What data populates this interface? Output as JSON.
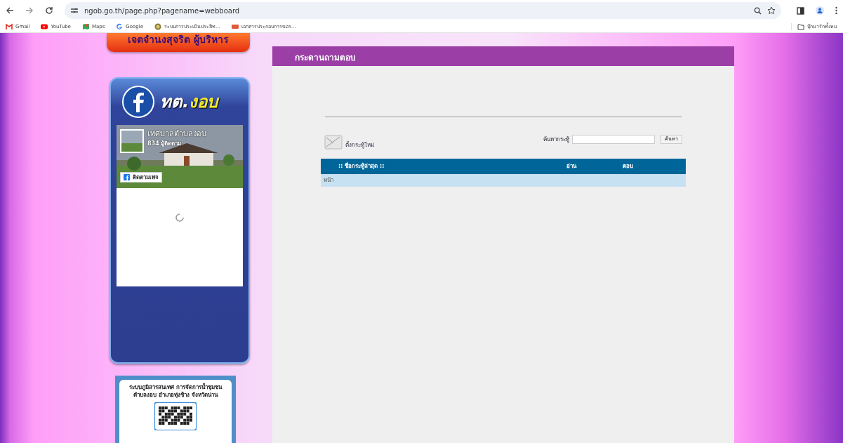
{
  "browser": {
    "url": "ngob.go.th/page.php?pagename=webboard",
    "bookmarks": [
      {
        "label": "Gmail",
        "kind": "gmail"
      },
      {
        "label": "YouTube",
        "kind": "youtube"
      },
      {
        "label": "Maps",
        "kind": "maps"
      },
      {
        "label": "Google",
        "kind": "google"
      },
      {
        "label": "ระบบการประเมินประสิท...",
        "kind": "seal"
      },
      {
        "label": "เอกสารประกอบการขอร...",
        "kind": "doc"
      }
    ],
    "all_bookmarks": "บุ๊กมาร์กทั้งหม"
  },
  "sidebar": {
    "banner": "เจตจำนงสุจริต ผู้บริหาร",
    "facebook": {
      "logo_prefix": "ทต.",
      "logo_name": "งอบ",
      "page_name": "เทศบาลตำบลงอบ",
      "followers": "834 ผู้ติดตาม",
      "follow_button": "ติดตามเพจ"
    },
    "qr_card": {
      "text": "ระบบภูมิสารสนเทศ การจัดการน้ำชุมชน ตำบลงอบ อำเภอทุ่งช้าง จังหวัดน่าน"
    }
  },
  "board": {
    "title": "กระดานถามตอบ",
    "new_topic": "ตั้งกระทู้ใหม่",
    "search_label": "ค้นหากระทู้",
    "search_button": "ค้นหา",
    "table": {
      "columns": [
        ":: ชื่อกระทู้ล่าสุด ::",
        "อ่าน",
        "ตอบ"
      ],
      "footer": "หน้า"
    }
  }
}
